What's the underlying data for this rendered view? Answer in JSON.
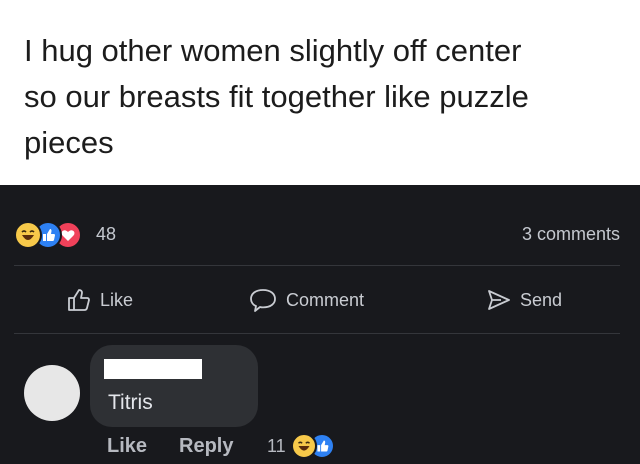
{
  "caption": {
    "lines": [
      "I hug other women slightly off center",
      "so our breasts fit together like puzzle",
      "pieces"
    ]
  },
  "post": {
    "reactions": {
      "icons": [
        "haha-reaction-icon",
        "like-reaction-icon",
        "love-reaction-icon"
      ],
      "count": "48"
    },
    "comments_count": "3 comments",
    "actions": {
      "like": "Like",
      "comment": "Comment",
      "send": "Send"
    }
  },
  "comment": {
    "text": "Titris",
    "like_label": "Like",
    "reply_label": "Reply",
    "reaction_count": "11",
    "reaction_icons": [
      "haha-reaction-icon",
      "like-reaction-icon"
    ]
  },
  "colors": {
    "background": "#18191d",
    "bubble": "#2e3034",
    "like_blue": "#2e81f3",
    "love_red": "#f0415a",
    "haha_yellow": "#f7c94a"
  }
}
